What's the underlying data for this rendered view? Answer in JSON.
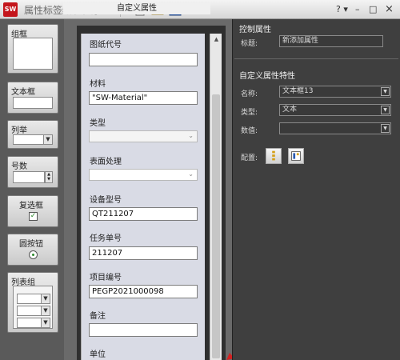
{
  "app": {
    "logo_text": "SW",
    "title": "属性标签编制程序",
    "window_controls": {
      "help": "? ▾",
      "minimize": "–",
      "maximize": "□",
      "close": "×"
    }
  },
  "toolbox": {
    "group_box": "组框",
    "text_box": "文本框",
    "list": "列举",
    "number": "号数",
    "checkbox": "复选框",
    "radio": "圆按钮",
    "list_group": "列表组"
  },
  "form": {
    "title": "自定义属性",
    "fields": [
      {
        "label": "图纸代号",
        "value": ""
      },
      {
        "label": "材料",
        "value": "\"SW-Material\""
      },
      {
        "label": "类型",
        "value": ""
      },
      {
        "label": "表面处理",
        "value": ""
      },
      {
        "label": "设备型号",
        "value": "QT211207"
      },
      {
        "label": "任务单号",
        "value": "211207"
      },
      {
        "label": "项目编号",
        "value": "PEGP2021000098"
      },
      {
        "label": "备注",
        "value": ""
      },
      {
        "label": "单位",
        "value": ""
      }
    ]
  },
  "properties": {
    "control_section": "控制属性",
    "title_label": "标题:",
    "title_value": "新添加属性",
    "custom_section": "自定义属性特性",
    "name_label": "名称:",
    "name_value": "文本框13",
    "type_label": "类型:",
    "type_value": "文本",
    "value_label": "数值:",
    "value_value": "",
    "config_label": "配置:"
  }
}
